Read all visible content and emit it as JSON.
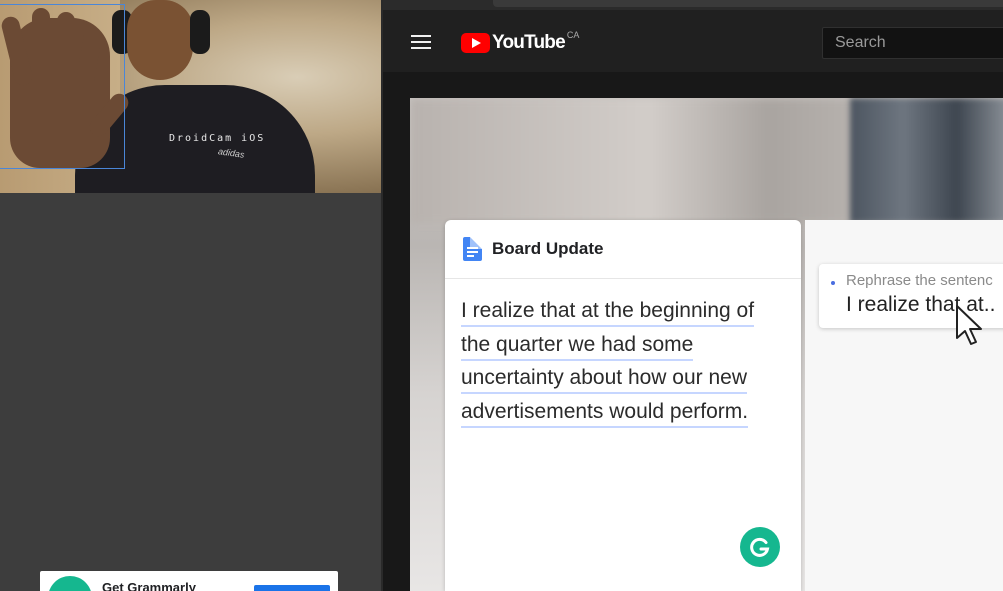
{
  "webcam": {
    "overlay_text": "DroidCam iOS",
    "shirt_text": "adidas"
  },
  "youtube": {
    "logo_text": "YouTube",
    "country_code": "CA",
    "search_placeholder": "Search"
  },
  "doc": {
    "title": "Board Update",
    "lines": [
      "I realize that at the beginning of",
      "the quarter we had some",
      "uncertainty about how our new",
      "advertisements would perform."
    ]
  },
  "suggestion": {
    "hint": "Rephrase the sentenc",
    "text": "I realize that at.."
  },
  "ad": {
    "text": "Get Grammarly"
  },
  "colors": {
    "youtube_red": "#ff0000",
    "grammarly_green": "#15b78f",
    "docs_blue": "#4285f4",
    "underline_blue": "#c6d6ff"
  }
}
